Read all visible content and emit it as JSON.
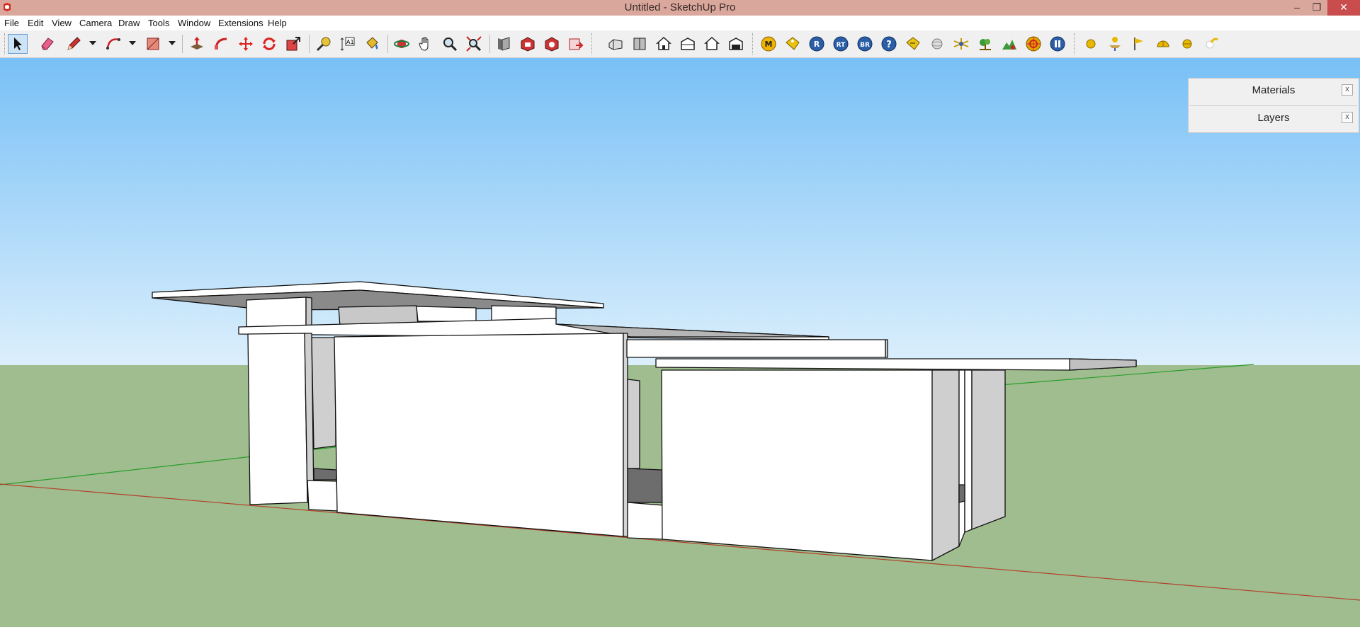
{
  "window": {
    "title": "Untitled - SketchUp Pro",
    "minimize": "–",
    "restore": "❐",
    "close": "✕"
  },
  "menu": [
    "File",
    "Edit",
    "View",
    "Camera",
    "Draw",
    "Tools",
    "Window",
    "Extensions",
    "Help"
  ],
  "toolbar": {
    "main_tools": [
      "select",
      "eraser",
      "line",
      "arc",
      "rectangle",
      "push-pull",
      "follow-me",
      "move",
      "rotate",
      "scale",
      "tape-measure",
      "dimension",
      "paint-bucket",
      "orbit",
      "pan",
      "zoom",
      "zoom-extents",
      "previous-view",
      "next-view",
      "3d-warehouse",
      "extension-warehouse",
      "send-to-layout"
    ],
    "view_tools": [
      "iso",
      "top",
      "front",
      "right",
      "back",
      "left"
    ],
    "plugin_badges": [
      "M",
      "",
      "R",
      "RT",
      "BR",
      "?",
      "",
      "",
      "",
      "",
      "",
      "",
      ""
    ],
    "sun_tools": [
      "sun",
      "shadow",
      "fog",
      "dome",
      "sphere",
      "glow"
    ]
  },
  "tray": {
    "items": [
      {
        "label": "Materials",
        "close": "x"
      },
      {
        "label": "Layers",
        "close": "x"
      }
    ]
  },
  "colors": {
    "sky_top": "#78c0f6",
    "sky_horizon": "#d9eefc",
    "ground": "#9fbd8f",
    "red_axis": "#b3402a",
    "green_axis": "#2a9d2a",
    "faces": "#ffffff",
    "shaded": "#7a7a7a"
  }
}
